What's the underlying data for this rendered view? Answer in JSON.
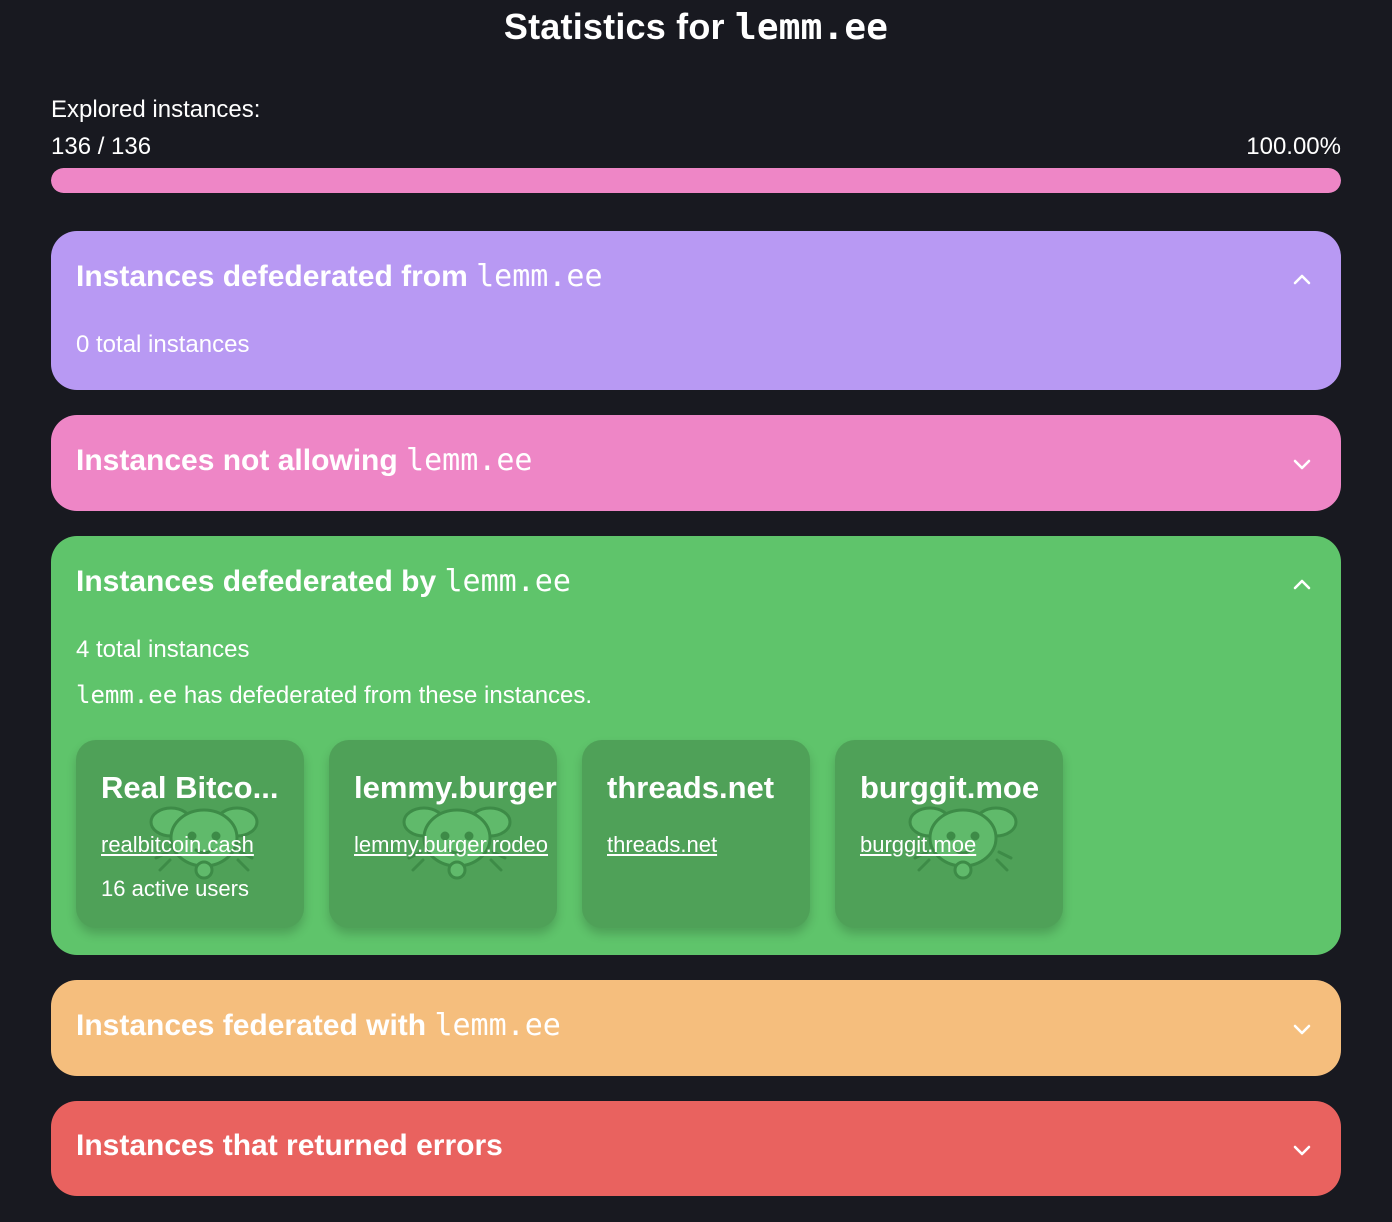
{
  "title": {
    "prefix": "Statistics for ",
    "instance": "lemm.ee"
  },
  "explored": {
    "label": "Explored instances:",
    "count": "136 / 136",
    "percent_text": "100.00%",
    "progress_fraction": 1.0
  },
  "colors": {
    "background": "#181920",
    "purple": "#b899f3",
    "pink": "#ee86c6",
    "green": "#5fc46b",
    "orange": "#f5be7d",
    "red": "#e9625f"
  },
  "panels": {
    "defederated_from": {
      "label": "Instances defederated from ",
      "instance": "lemm.ee",
      "expanded": true,
      "chevron_icon": "chevron-up-icon",
      "total": "0 total instances"
    },
    "not_allowing": {
      "label": "Instances not allowing ",
      "instance": "lemm.ee",
      "expanded": false,
      "chevron_icon": "chevron-down-icon"
    },
    "defederated_by": {
      "label": "Instances defederated by ",
      "instance": "lemm.ee",
      "expanded": true,
      "chevron_icon": "chevron-up-icon",
      "total": "4 total instances",
      "description_instance": "lemm.ee",
      "description": " has defederated from these instances.",
      "cards": [
        {
          "name": "Real Bitco...",
          "domain": "realbitcoin.cash",
          "users": "16 active users",
          "logo_icon": "lemmy-mouse-icon"
        },
        {
          "name": "lemmy.burger.rodeo",
          "domain": "lemmy.burger.rodeo",
          "users": "",
          "logo_icon": "lemmy-mouse-icon"
        },
        {
          "name": "threads.net",
          "domain": "threads.net",
          "users": "",
          "logo_icon": ""
        },
        {
          "name": "burggit.moe",
          "domain": "burggit.moe",
          "users": "",
          "logo_icon": "lemmy-mouse-icon"
        }
      ]
    },
    "federated_with": {
      "label": "Instances federated with ",
      "instance": "lemm.ee",
      "expanded": false,
      "chevron_icon": "chevron-down-icon"
    },
    "errors": {
      "label": "Instances that returned errors",
      "expanded": false,
      "chevron_icon": "chevron-down-icon"
    }
  }
}
